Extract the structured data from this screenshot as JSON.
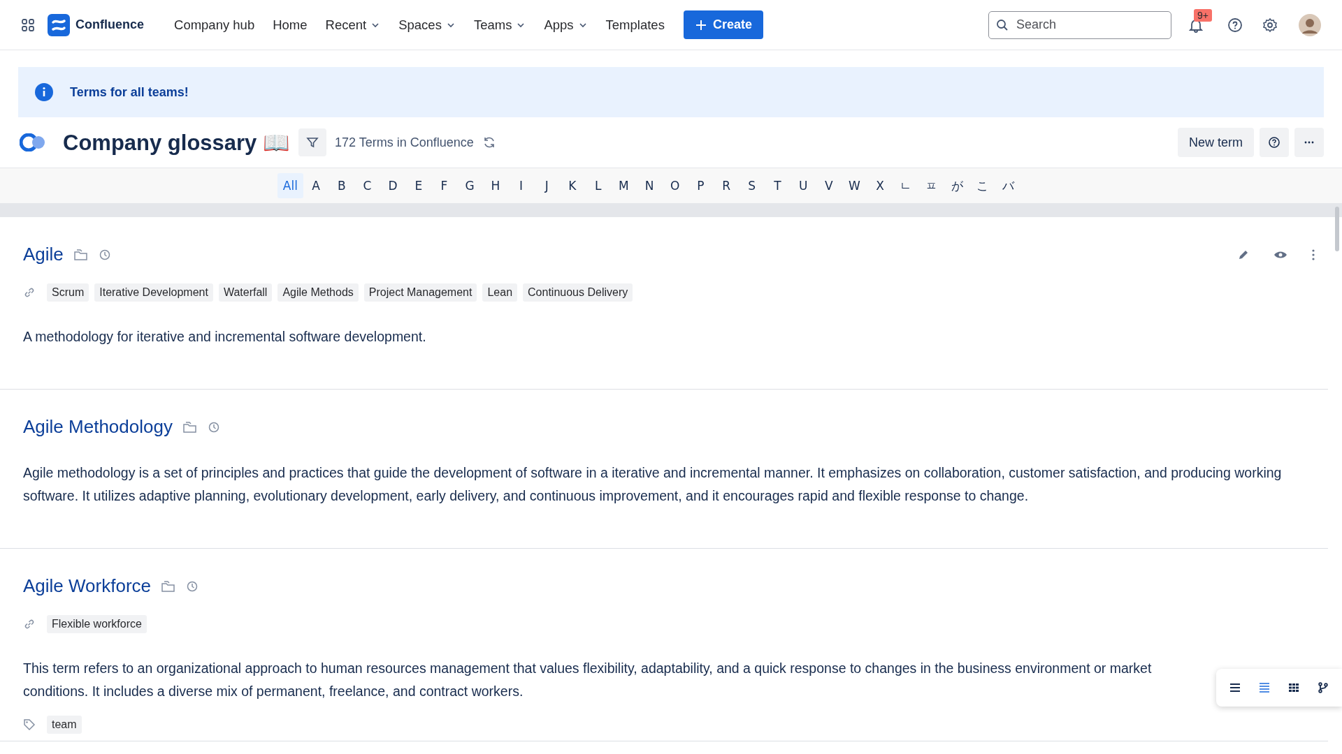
{
  "nav": {
    "product": "Confluence",
    "items": [
      {
        "label": "Company hub",
        "dropdown": false
      },
      {
        "label": "Home",
        "dropdown": false
      },
      {
        "label": "Recent",
        "dropdown": true
      },
      {
        "label": "Spaces",
        "dropdown": true
      },
      {
        "label": "Teams",
        "dropdown": true
      },
      {
        "label": "Apps",
        "dropdown": true
      },
      {
        "label": "Templates",
        "dropdown": false
      }
    ],
    "create": "Create",
    "search": {
      "placeholder": "Search"
    },
    "notifications": "9+"
  },
  "banner": {
    "text": "Terms for all teams!"
  },
  "header": {
    "title": "Company glossary 📖",
    "count": "172 Terms in Confluence",
    "new_term": "New term"
  },
  "letters": [
    {
      "label": "All",
      "selected": true
    },
    {
      "label": "A",
      "selected": false
    },
    {
      "label": "B",
      "selected": false
    },
    {
      "label": "C",
      "selected": false
    },
    {
      "label": "D",
      "selected": false
    },
    {
      "label": "E",
      "selected": false
    },
    {
      "label": "F",
      "selected": false
    },
    {
      "label": "G",
      "selected": false
    },
    {
      "label": "H",
      "selected": false
    },
    {
      "label": "I",
      "selected": false
    },
    {
      "label": "J",
      "selected": false
    },
    {
      "label": "K",
      "selected": false
    },
    {
      "label": "L",
      "selected": false
    },
    {
      "label": "M",
      "selected": false
    },
    {
      "label": "N",
      "selected": false
    },
    {
      "label": "O",
      "selected": false
    },
    {
      "label": "P",
      "selected": false
    },
    {
      "label": "R",
      "selected": false
    },
    {
      "label": "S",
      "selected": false
    },
    {
      "label": "T",
      "selected": false
    },
    {
      "label": "U",
      "selected": false
    },
    {
      "label": "V",
      "selected": false
    },
    {
      "label": "W",
      "selected": false
    },
    {
      "label": "X",
      "selected": false
    },
    {
      "label": "ㄴ",
      "selected": false
    },
    {
      "label": "ㅍ",
      "selected": false
    },
    {
      "label": "が",
      "selected": false
    },
    {
      "label": "こ",
      "selected": false
    },
    {
      "label": "バ",
      "selected": false
    }
  ],
  "terms": [
    {
      "title": "Agile",
      "actions": true,
      "synonyms": [
        "Scrum",
        "Iterative Development",
        "Waterfall",
        "Agile Methods",
        "Project Management",
        "Lean",
        "Continuous Delivery"
      ],
      "definition": "A methodology for iterative and incremental software development."
    },
    {
      "title": "Agile Methodology",
      "actions": false,
      "definition": "Agile methodology is a set of principles and practices that guide the development of software in a iterative and incremental manner. It emphasizes on collaboration, customer satisfaction, and producing working software. It utilizes adaptive planning, evolutionary development, early delivery, and continuous improvement, and it encourages rapid and flexible response to change."
    },
    {
      "title": "Agile Workforce",
      "actions": false,
      "synonyms": [
        "Flexible workforce"
      ],
      "definition": "This term refers to an organizational approach to human resources management that values flexibility, adaptability, and a quick response to changes in the business environment or market conditions. It includes a diverse mix of permanent, freelance, and contract workers.",
      "labels": [
        "team"
      ]
    }
  ],
  "views": [
    {
      "kind": "list",
      "selected": false
    },
    {
      "kind": "compact",
      "selected": true
    },
    {
      "kind": "grid",
      "selected": false
    },
    {
      "kind": "tree",
      "selected": false
    }
  ]
}
